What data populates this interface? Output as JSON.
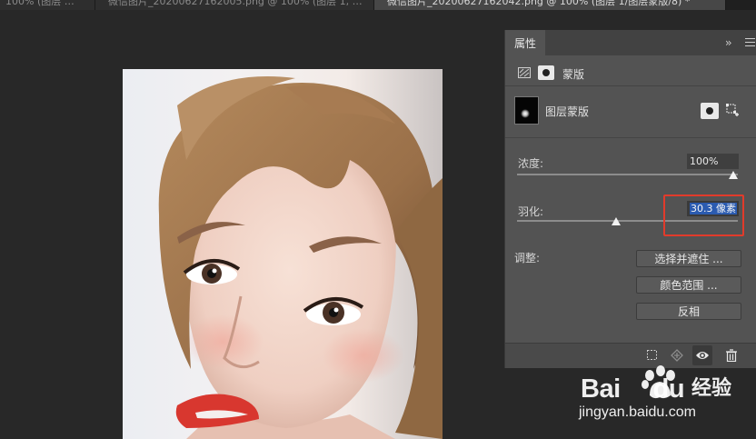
{
  "document_tabs": [
    {
      "label": "100% (图层 …",
      "active": false
    },
    {
      "label": "微信图片_20200627162005.png @ 100% (图层 1, …",
      "active": false
    },
    {
      "label": "微信图片_20200627162042.png @ 100% (图层 1/图层蒙版/8) *",
      "active": true
    }
  ],
  "properties": {
    "tab": "属性",
    "mask_type": "蒙版",
    "layer_mask_label": "图层蒙版",
    "density_label": "浓度:",
    "density_value": "100%",
    "density_level": 1.0,
    "feather_label": "羽化:",
    "feather_value": "30.3 像素",
    "feather_level": 0.45,
    "adjust_label": "调整:",
    "buttons": {
      "refine": "选择并遮住 ...",
      "color_range": "颜色范围 ...",
      "invert": "反相"
    },
    "footer_icons": [
      "load-selection-icon",
      "apply-mask-icon",
      "visibility-eye-icon",
      "trash-icon"
    ]
  },
  "watermark": {
    "brand": "Bai",
    "brand_suffix": "du",
    "cn": "经验",
    "url": "jingyan.baidu.com"
  },
  "colors": {
    "highlight": "#e23b2b",
    "selection": "#2b5bb0",
    "panel": "#535353",
    "canvas": "#282828"
  }
}
